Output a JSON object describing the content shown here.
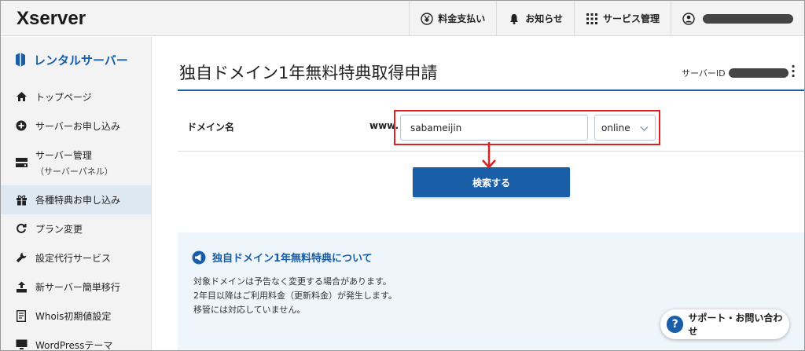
{
  "header": {
    "logo": "Xserver",
    "nav": [
      {
        "label": "料金支払い",
        "icon": "yen-icon"
      },
      {
        "label": "お知らせ",
        "icon": "bell-icon"
      },
      {
        "label": "サービス管理",
        "icon": "grid-icon"
      }
    ],
    "user_icon": "user-icon"
  },
  "sidebar": {
    "title": "レンタルサーバー",
    "items": [
      {
        "label": "トップページ",
        "icon": "home-icon"
      },
      {
        "label": "サーバーお申し込み",
        "icon": "plus-circle-icon"
      },
      {
        "label": "サーバー管理",
        "sub": "（サーバーパネル）",
        "icon": "server-icon"
      },
      {
        "label": "各種特典お申し込み",
        "icon": "gift-icon",
        "active": true
      },
      {
        "label": "プラン変更",
        "icon": "refresh-icon"
      },
      {
        "label": "設定代行サービス",
        "icon": "wrench-icon"
      },
      {
        "label": "新サーバー簡単移行",
        "icon": "upload-icon"
      },
      {
        "label": "Whois初期値設定",
        "icon": "document-icon"
      },
      {
        "label": "WordPressテーマ",
        "icon": "monitor-icon"
      }
    ]
  },
  "main": {
    "title": "独自ドメイン1年無料特典取得申請",
    "server_id_label": "サーバーID",
    "form": {
      "domain_label": "ドメイン名",
      "prefix": "www.",
      "domain_value": "sabameijin",
      "tld_value": "online"
    },
    "search_button": "検索する",
    "info": {
      "title": "独自ドメイン1年無料特典について",
      "lines": [
        "対象ドメインは予告なく変更する場合があります。",
        "2年目以降はご利用料金（更新料金）が発生します。",
        "移管には対応していません。"
      ]
    },
    "support_label": "サポート・お問い合わせ"
  },
  "colors": {
    "accent": "#1a5ea8",
    "highlight": "#e02020",
    "sidebar_bg": "#f3f3f3",
    "active_bg": "#dde8f3",
    "info_bg": "#eef5fb"
  }
}
